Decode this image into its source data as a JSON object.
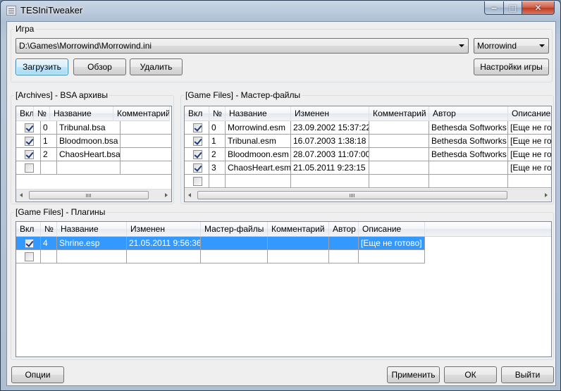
{
  "window": {
    "title": "TESIniTweaker",
    "controls": {
      "minimize": "‒",
      "maximize": "□",
      "close": "✕"
    }
  },
  "game_group": {
    "title": "Игра",
    "ini_path": "D:\\Games\\Morrowind\\Morrowind.ini",
    "game_select": "Morrowind",
    "load_button": "Загрузить",
    "browse_button": "Обзор",
    "delete_button": "Удалить",
    "game_settings_button": "Настройки игры"
  },
  "archives": {
    "title": "[Archives] - BSA архивы",
    "columns": [
      "Вкл",
      "№",
      "Название",
      "Комментарий"
    ],
    "rows": [
      {
        "checked": true,
        "num": "0",
        "name": "Tribunal.bsa",
        "comment": ""
      },
      {
        "checked": true,
        "num": "1",
        "name": "Bloodmoon.bsa",
        "comment": ""
      },
      {
        "checked": true,
        "num": "2",
        "name": "ChaosHeart.bsa",
        "comment": ""
      },
      {
        "checked": false,
        "num": "",
        "name": "",
        "comment": ""
      }
    ]
  },
  "masters": {
    "title": "[Game Files] - Мастер-файлы",
    "columns": [
      "Вкл",
      "№",
      "Название",
      "Изменен",
      "Комментарий",
      "Автор",
      "Описание"
    ],
    "rows": [
      {
        "checked": true,
        "num": "0",
        "name": "Morrowind.esm",
        "modified": "23.09.2002 15:37:22",
        "comment": "",
        "author": "Bethesda Softworks",
        "description": "[Еще не готово]"
      },
      {
        "checked": true,
        "num": "1",
        "name": "Tribunal.esm",
        "modified": "16.07.2003 1:38:18",
        "comment": "",
        "author": "Bethesda Softworks",
        "description": "[Еще не готово]"
      },
      {
        "checked": true,
        "num": "2",
        "name": "Bloodmoon.esm",
        "modified": "28.07.2003 11:07:00",
        "comment": "",
        "author": "Bethesda Softworks",
        "description": "[Еще не готово]"
      },
      {
        "checked": true,
        "num": "3",
        "name": "ChaosHeart.esm",
        "modified": "21.05.2011 9:23:15",
        "comment": "",
        "author": "",
        "description": "[Еще не готово]"
      },
      {
        "checked": false,
        "num": "",
        "name": "",
        "modified": "",
        "comment": "",
        "author": "",
        "description": ""
      }
    ]
  },
  "plugins": {
    "title": "[Game Files] - Плагины",
    "columns": [
      "Вкл",
      "№",
      "Название",
      "Изменен",
      "Мастер-файлы",
      "Комментарий",
      "Автор",
      "Описание"
    ],
    "rows": [
      {
        "checked": true,
        "selected": true,
        "num": "4",
        "name": "Shrine.esp",
        "modified": "21.05.2011 9:56:36",
        "masters": "",
        "comment": "",
        "author": "",
        "description": "[Еще не готово]"
      },
      {
        "checked": false,
        "selected": false,
        "num": "",
        "name": "",
        "modified": "",
        "masters": "",
        "comment": "",
        "author": "",
        "description": ""
      }
    ]
  },
  "footer": {
    "options_button": "Опции",
    "apply_button": "Применить",
    "ok_button": "ОК",
    "exit_button": "Выйти"
  }
}
